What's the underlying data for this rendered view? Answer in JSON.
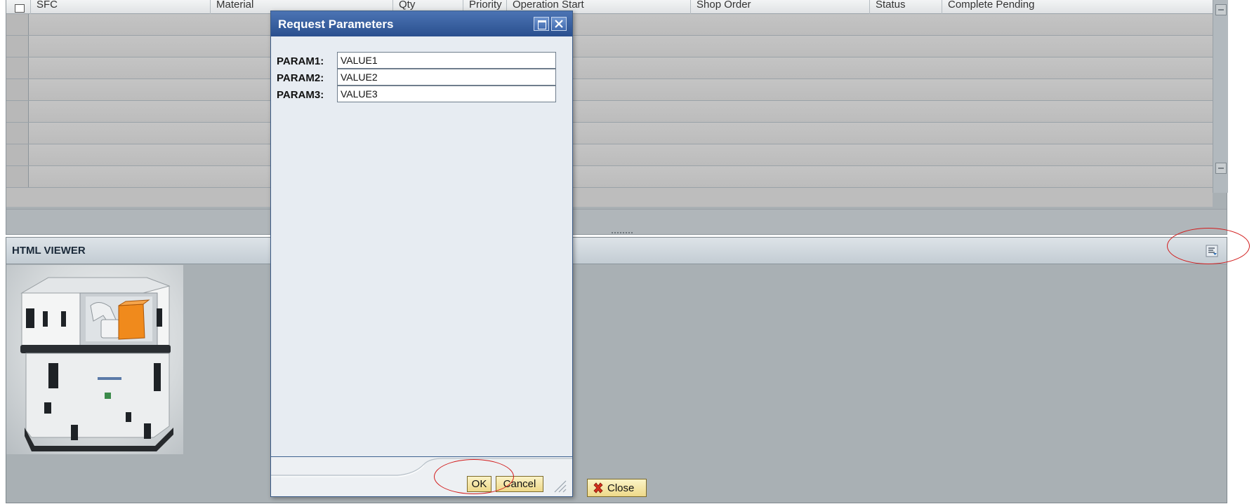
{
  "grid": {
    "columns": [
      {
        "label": "SFC"
      },
      {
        "label": "Material"
      },
      {
        "label": "Qty"
      },
      {
        "label": "Priority"
      },
      {
        "label": "Operation Start"
      },
      {
        "label": "Shop Order"
      },
      {
        "label": "Status"
      },
      {
        "label": "Complete Pending"
      }
    ],
    "rows": [
      {},
      {},
      {},
      {},
      {},
      {},
      {},
      {}
    ]
  },
  "viewer": {
    "title": "HTML VIEWER",
    "menu_icon": "list-settings-icon"
  },
  "dialog": {
    "title": "Request Parameters",
    "params": [
      {
        "label": "PARAM1:",
        "value": "VALUE1"
      },
      {
        "label": "PARAM2:",
        "value": "VALUE2"
      },
      {
        "label": "PARAM3:",
        "value": "VALUE3"
      }
    ],
    "ok_label": "OK",
    "cancel_label": "Cancel"
  },
  "close_button": {
    "label": "Close",
    "icon": "red-x-icon"
  },
  "colors": {
    "dialog_title_bar": "#2a4f8e",
    "button_face": "#eed889",
    "annotation": "#d21c1c"
  }
}
